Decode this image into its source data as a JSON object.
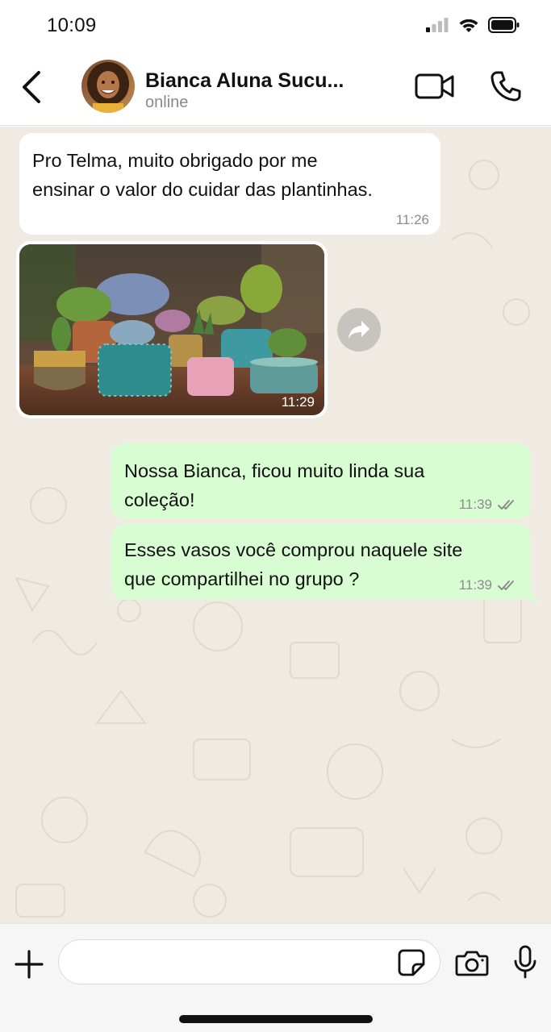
{
  "status_bar": {
    "time": "10:09",
    "icons": [
      "signal-icon",
      "wifi-icon",
      "battery-icon"
    ]
  },
  "header": {
    "contact_name": "Bianca Aluna Sucu...",
    "contact_status": "online",
    "icons": [
      "back-chevron-icon",
      "video-call-icon",
      "phone-call-icon"
    ]
  },
  "messages": [
    {
      "direction": "incoming",
      "type": "text",
      "lines": [
        "Pro Telma, muito obrigado por me",
        "ensinar o valor do cuidar das plantinhas."
      ],
      "time": "11:26"
    },
    {
      "direction": "incoming",
      "type": "image",
      "image_description": "succulent-pots-photo",
      "time": "11:29"
    },
    {
      "direction": "outgoing",
      "type": "text",
      "lines": [
        "Nossa Bianca, ficou muito linda sua",
        "coleção!"
      ],
      "time": "11:39",
      "status": "read-ticks"
    },
    {
      "direction": "outgoing",
      "type": "text",
      "lines": [
        "Esses vasos você comprou naquele site",
        "que compartilhei no grupo ?"
      ],
      "time": "11:39",
      "status": "read-ticks"
    }
  ],
  "composer": {
    "input_value": "",
    "icons": [
      "plus-icon",
      "sticker-icon",
      "camera-icon",
      "microphone-icon"
    ]
  },
  "colors": {
    "chat_background": "#efeae2",
    "incoming_bubble": "#ffffff",
    "outgoing_bubble": "#d9fdd3",
    "tick_color": "#8c8c8c"
  }
}
